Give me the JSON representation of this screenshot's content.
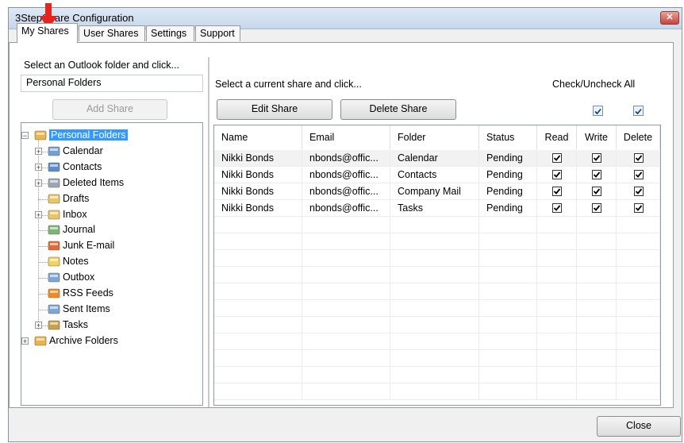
{
  "window": {
    "title": "3StepShare Configuration",
    "close_glyph": "✕"
  },
  "tabs": [
    {
      "label": "My Shares",
      "active": true
    },
    {
      "label": "User Shares",
      "active": false
    },
    {
      "label": "Settings",
      "active": false
    },
    {
      "label": "Support",
      "active": false
    }
  ],
  "left": {
    "prompt": "Select an Outlook folder and click...",
    "selected_folder": "Personal Folders",
    "add_button": "Add Share",
    "tree": [
      {
        "label": "Personal Folders",
        "icon": "personal-folders-icon",
        "selected": true
      },
      {
        "label": "Calendar",
        "icon": "calendar-icon"
      },
      {
        "label": "Contacts",
        "icon": "contacts-icon"
      },
      {
        "label": "Deleted Items",
        "icon": "deleted-items-icon"
      },
      {
        "label": "Drafts",
        "icon": "drafts-icon"
      },
      {
        "label": "Inbox",
        "icon": "inbox-icon"
      },
      {
        "label": "Journal",
        "icon": "journal-icon"
      },
      {
        "label": "Junk E-mail",
        "icon": "junk-email-icon"
      },
      {
        "label": "Notes",
        "icon": "notes-icon"
      },
      {
        "label": "Outbox",
        "icon": "outbox-icon"
      },
      {
        "label": "RSS Feeds",
        "icon": "rss-feeds-icon"
      },
      {
        "label": "Sent Items",
        "icon": "sent-items-icon"
      },
      {
        "label": "Tasks",
        "icon": "tasks-icon"
      },
      {
        "label": "Archive Folders",
        "icon": "archive-folders-icon"
      }
    ]
  },
  "right": {
    "prompt": "Select a current share and click...",
    "check_all_label": "Check/Uncheck All",
    "edit_button": "Edit Share",
    "delete_button": "Delete Share",
    "columns": [
      "Name",
      "Email",
      "Folder",
      "Status",
      "Read",
      "Write",
      "Delete"
    ],
    "rows": [
      {
        "name": "Nikki Bonds",
        "email": "nbonds@offic...",
        "folder": "Calendar",
        "status": "Pending",
        "read": true,
        "write": true,
        "delete": true
      },
      {
        "name": "Nikki Bonds",
        "email": "nbonds@offic...",
        "folder": "Contacts",
        "status": "Pending",
        "read": true,
        "write": true,
        "delete": true
      },
      {
        "name": "Nikki Bonds",
        "email": "nbonds@offic...",
        "folder": "Company Mail",
        "status": "Pending",
        "read": true,
        "write": true,
        "delete": true
      },
      {
        "name": "Nikki Bonds",
        "email": "nbonds@offic...",
        "folder": "Tasks",
        "status": "Pending",
        "read": true,
        "write": true,
        "delete": true
      }
    ]
  },
  "footer": {
    "close_button": "Close"
  },
  "colors": {
    "selection": "#3399ff",
    "annotation_arrow": "#e8231e"
  }
}
